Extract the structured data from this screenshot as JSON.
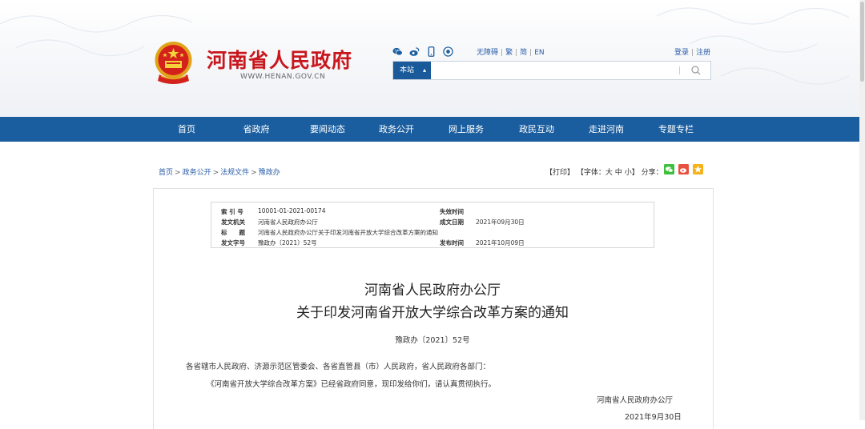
{
  "header": {
    "site_title": "河南省人民政府",
    "site_url": "WWW.HENAN.GOV.CN",
    "social_icons": [
      "wechat-icon",
      "weibo-icon",
      "mobile-icon",
      "app-icon"
    ],
    "lang_links": [
      "无障碍",
      "繁",
      "简",
      "EN"
    ],
    "auth_links": [
      "登录",
      "注册"
    ],
    "search": {
      "scope": "本站",
      "value": "",
      "placeholder": ""
    }
  },
  "nav": {
    "items": [
      "首页",
      "省政府",
      "要闻动态",
      "政务公开",
      "网上服务",
      "政民互动",
      "走进河南",
      "专题专栏"
    ]
  },
  "breadcrumb": [
    "首页",
    "政务公开",
    "法规文件",
    "豫政办"
  ],
  "tools": {
    "print": "【打印】",
    "font_label": "【字体：",
    "font_large": "大",
    "font_medium": "中",
    "font_small": "小",
    "font_end": "】",
    "share_label": "分享：",
    "share_icons": [
      "wechat-share-icon",
      "weibo-share-icon",
      "qzone-share-icon"
    ]
  },
  "meta": {
    "index_label": "索 引 号",
    "index_value": "10001-01-2021-00174",
    "valid_label": "失效时间",
    "valid_value": "",
    "issuer_label": "发文机关",
    "issuer_value": "河南省人民政府办公厅",
    "created_label": "成文日期",
    "created_value": "2021年09月30日",
    "title_label": "标　　题",
    "title_value": "河南省人民政府办公厅关于印发河南省开放大学综合改革方案的通知",
    "docno_label": "发文字号",
    "docno_value": "豫政办〔2021〕52号",
    "publish_label": "发布时间",
    "publish_value": "2021年10月09日"
  },
  "document": {
    "title_line1": "河南省人民政府办公厅",
    "title_line2": "关于印发河南省开放大学综合改革方案的通知",
    "doc_number": "豫政办〔2021〕52号",
    "addressee": "各省辖市人民政府、济源示范区管委会、各省直管县（市）人民政府，省人民政府各部门：",
    "body": "《河南省开放大学综合改革方案》已经省政府同意，现印发给你们，请认真贯彻执行。",
    "signer": "河南省人民政府办公厅",
    "date": "2021年9月30日"
  },
  "colors": {
    "brand_red": "#c8161d",
    "nav_blue": "#1b5e9f",
    "link_blue": "#2b5ea8"
  }
}
